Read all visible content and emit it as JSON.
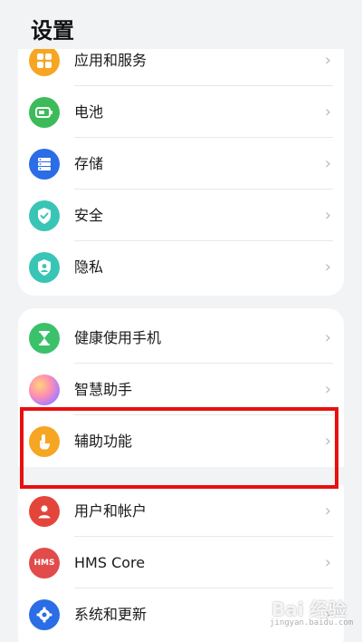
{
  "header": {
    "title": "设置"
  },
  "card1": {
    "items": [
      {
        "label": "应用和服务",
        "icon": "apps-grid-icon",
        "color": "#f6a623"
      },
      {
        "label": "电池",
        "icon": "battery-icon",
        "color": "#3dbb5a"
      },
      {
        "label": "存储",
        "icon": "storage-icon",
        "color": "#2a6de6"
      },
      {
        "label": "安全",
        "icon": "shield-check-icon",
        "color": "#39c5b5"
      },
      {
        "label": "隐私",
        "icon": "privacy-icon",
        "color": "#39c5b5"
      }
    ]
  },
  "card2": {
    "items": [
      {
        "label": "健康使用手机",
        "icon": "hourglass-icon",
        "color": "#3cc16b"
      },
      {
        "label": "智慧助手",
        "icon": "assistant-orb-icon",
        "color": "#d77cd6"
      },
      {
        "label": "辅助功能",
        "icon": "hand-pointer-icon",
        "color": "#f6a623"
      },
      {
        "label": "用户和帐户",
        "icon": "user-icon",
        "color": "#e4453b"
      },
      {
        "label": "HMS Core",
        "icon": "hms-icon",
        "color": "#e24b4b",
        "badge": "HMS"
      },
      {
        "label": "系统和更新",
        "icon": "gear-icon",
        "color": "#2a6de6"
      }
    ]
  },
  "chevron": "›",
  "highlight_color": "#e81010",
  "watermark": {
    "main": "Bai 经验",
    "sub": "jingyan.baidu.com"
  }
}
